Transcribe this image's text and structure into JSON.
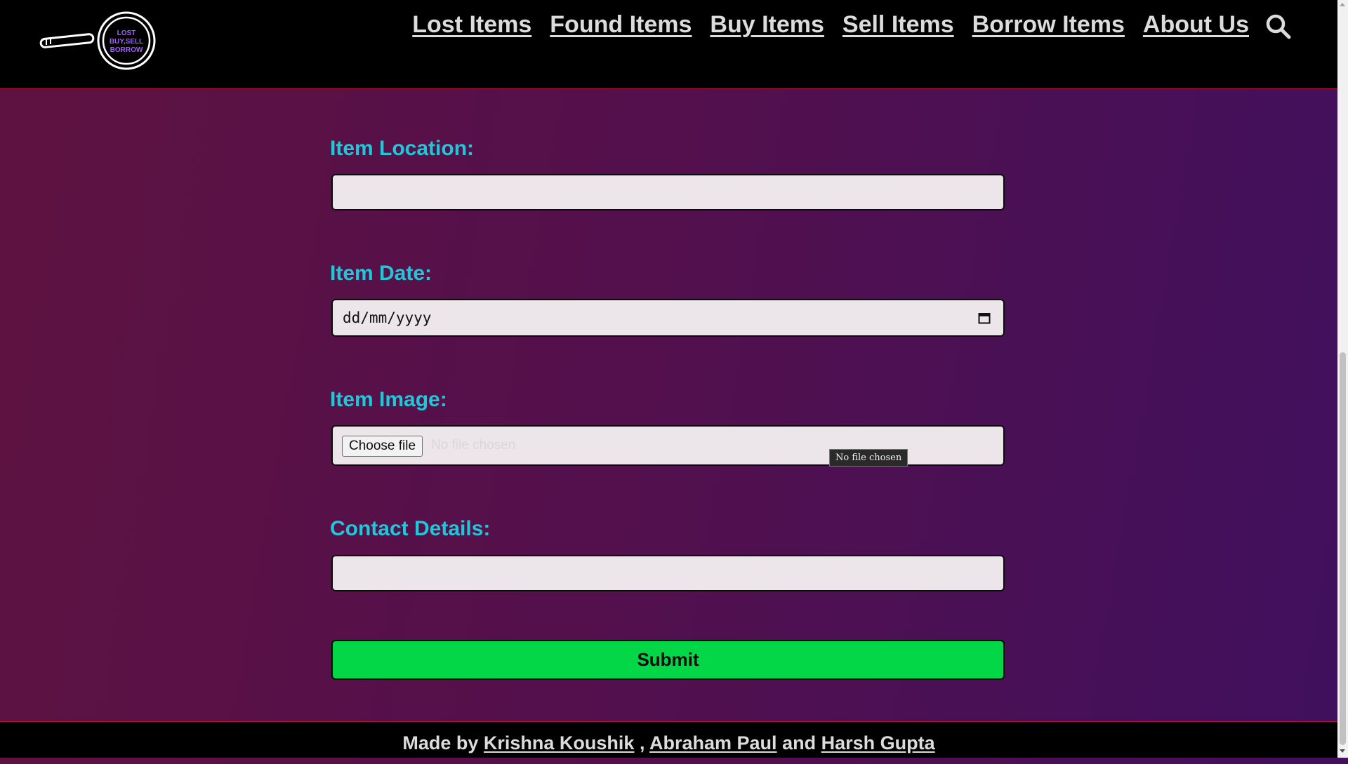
{
  "header": {
    "logo": {
      "lines": [
        "LOST",
        "BUY,SELL",
        "BORROW"
      ],
      "icon": "magnifier-logo",
      "accent": "#a35cff"
    },
    "nav": [
      "Lost Items",
      "Found Items",
      "Buy Items",
      "Sell Items",
      "Borrow Items",
      "About Us"
    ],
    "search_icon": "search-icon"
  },
  "form": {
    "location": {
      "label": "Item Location:",
      "value": ""
    },
    "date": {
      "label": "Item Date:",
      "placeholder": "dd/mm/yyyy",
      "icon": "calendar-icon"
    },
    "image": {
      "label": "Item Image:",
      "button": "Choose file",
      "status": "No file chosen",
      "tooltip": "No file chosen"
    },
    "contact": {
      "label": "Contact Details:",
      "value": ""
    },
    "submit": "Submit"
  },
  "footer": {
    "prefix": "Made by",
    "author1": "Krishna Koushik",
    "sep": ",",
    "author2": "Abraham Paul",
    "conj": "and",
    "author3": "Harsh Gupta"
  },
  "colors": {
    "header_bg": "#000000",
    "label": "#1fc8d8",
    "submit_bg": "#03d647",
    "border_accent": "#b3123a",
    "bg_left": "#5e1240",
    "bg_right": "#40105e"
  }
}
